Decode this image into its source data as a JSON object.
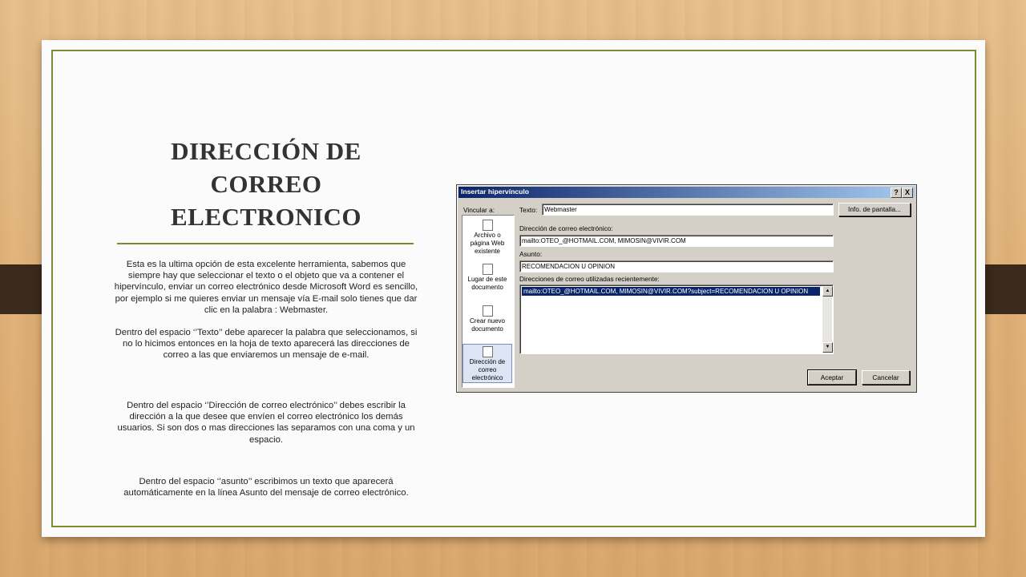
{
  "slide": {
    "title_lines": [
      "DIRECCIÓN DE",
      "CORREO",
      "ELECTRONICO"
    ],
    "paragraphs": [
      "Esta es la ultima opción de esta excelente herramienta, sabemos que siempre hay que seleccionar el texto o el objeto que va a contener el hipervínculo, enviar un correo electrónico desde Microsoft Word es sencillo, por ejemplo si me quieres enviar un mensaje vía E-mail solo tienes que dar clic en la palabra : Webmaster.",
      "Dentro del espacio ‘’Texto’’ debe aparecer la palabra que seleccionamos, si no lo hicimos entonces en la hoja de texto aparecerá las direcciones de correo a las que enviaremos un mensaje de e-mail.",
      "Dentro del espacio ‘’Dirección de correo electrónico’’ debes escribir la dirección a la que desee que envíen el correo electrónico los demás usuarios. Si son dos o mas direcciones las separamos con una coma y un espacio.",
      "Dentro del espacio ‘’asunto’’ escribimos un texto que aparecerá automáticamente en la línea Asunto del mensaje de correo electrónico."
    ]
  },
  "dialog": {
    "title": "Insertar hipervínculo",
    "help_btn": "?",
    "close_btn": "X",
    "link_to_label": "Vincular a:",
    "sidebar": [
      {
        "line1": "Archivo o",
        "line2": "página Web",
        "line3": "existente"
      },
      {
        "line1": "Lugar de este",
        "line2": "documento",
        "line3": ""
      },
      {
        "line1": "Crear nuevo",
        "line2": "documento",
        "line3": ""
      },
      {
        "line1": "Dirección de",
        "line2": "correo",
        "line3": "electrónico"
      }
    ],
    "text_label": "Texto:",
    "text_value": "Webmaster",
    "screentip_btn": "Info. de pantalla...",
    "email_label": "Dirección de correo electrónico:",
    "email_value": "mailto:OTEO_@HOTMAIL.COM, MIMOSIN@VIVIR.COM",
    "subject_label": "Asunto:",
    "subject_value": "RECOMENDACION U OPINION",
    "recent_label": "Direcciones de correo utilizadas recientemente:",
    "recent_items": [
      "mailto:OTEO_@HOTMAIL.COM, MIMOSIN@VIVIR.COM?subject=RECOMENDACION U OPINION"
    ],
    "ok_btn": "Aceptar",
    "cancel_btn": "Cancelar"
  }
}
